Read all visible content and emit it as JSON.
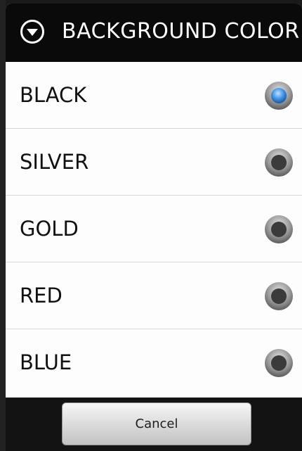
{
  "dialog": {
    "title": "BACKGROUND COLOR",
    "title_icon": "chevron-down-circle-icon"
  },
  "options": [
    {
      "label": "BLACK",
      "selected": true
    },
    {
      "label": "SILVER",
      "selected": false
    },
    {
      "label": "GOLD",
      "selected": false
    },
    {
      "label": "RED",
      "selected": false
    },
    {
      "label": "BLUE",
      "selected": false
    }
  ],
  "buttons": {
    "cancel_label": "Cancel"
  },
  "colors": {
    "title_bar": "#0a0a0a",
    "list_bg": "#fdfdfd",
    "radio_selected": "#3d8fe0",
    "radio_unselected": "#3a3a3a"
  }
}
